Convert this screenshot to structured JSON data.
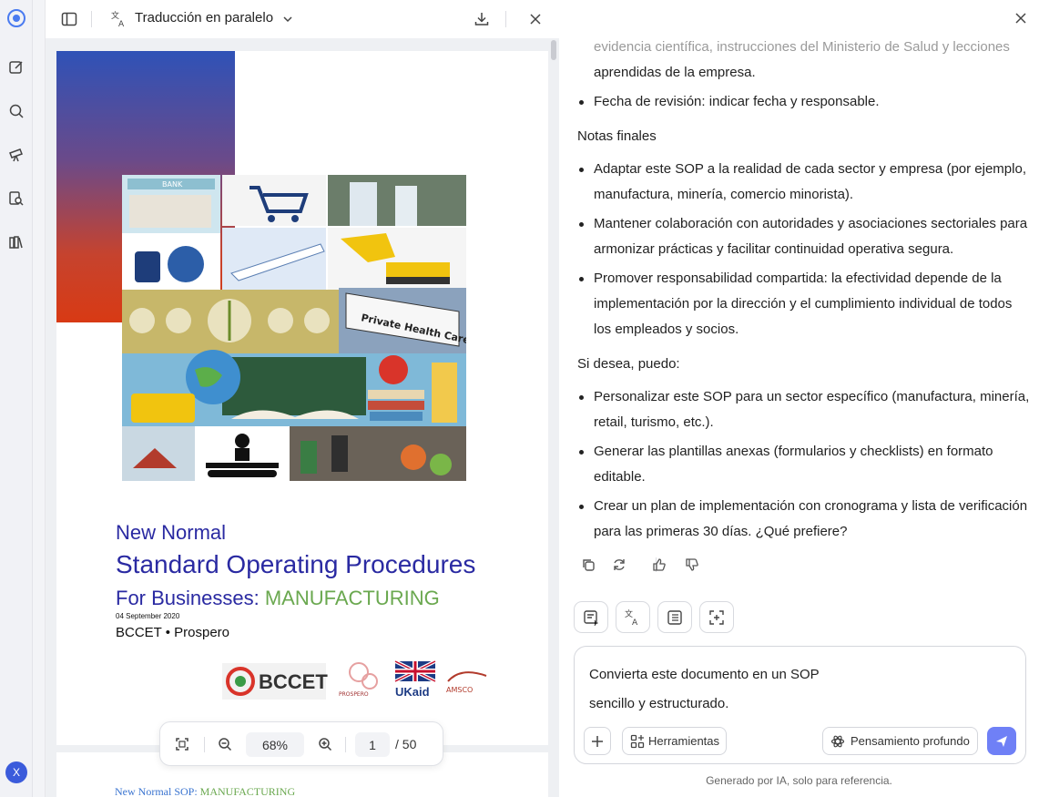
{
  "toolbar": {
    "title": "Traducción en paralelo"
  },
  "document": {
    "subtitle_top": "New Normal",
    "title": "Standard Operating Procedures",
    "for_businesses": "For Businesses: ",
    "sector": "MANUFACTURING",
    "date": "04 September 2020",
    "org": "BCCET • Prospero",
    "logo_text": "BCCET",
    "page2_prefix": "New Normal SOP: ",
    "page2_sector": "MANUFACTURING",
    "collage_labels": {
      "bank": "BANK",
      "health": "Private Health Care"
    },
    "logo_prospero": "PROSPERO",
    "logo_ukaid": "UKaid",
    "logo_amsco": "AMSCO"
  },
  "zoom": {
    "level": "68%",
    "page": "1",
    "total": "/ 50"
  },
  "chat": {
    "faded_line": "evidencia científica, instrucciones del Ministerio de Salud y lecciones",
    "cont_line": "aprendidas de la empresa.",
    "revision": "Fecha de revisión: indicar fecha y responsable.",
    "notes_heading": "Notas finales",
    "notes": [
      "Adaptar este SOP a la realidad de cada sector y empresa (por ejemplo, manufactura, minería, comercio minorista).",
      "Mantener colaboración con autoridades y asociaciones sectoriales para armonizar prácticas y facilitar continuidad operativa segura.",
      "Promover responsabilidad compartida: la efectividad depende de la implementación por la dirección y el cumplimiento individual de todos los empleados y socios."
    ],
    "offer_heading": "Si desea, puedo:",
    "offers": [
      "Personalizar este SOP para un sector específico (manufactura, minería, retail, turismo, etc.).",
      "Generar las plantillas anexas (formularios y checklists) en formato editable.",
      "Crear un plan de implementación con cronograma y lista de verificación para las primeras 30 días. ¿Qué prefiere?"
    ]
  },
  "composer": {
    "text": "Convierta este documento en un SOP sencillo y estructurado.",
    "tools_label": "Herramientas",
    "deep_label": "Pensamiento profundo"
  },
  "footer": "Generado por IA, solo para referencia.",
  "user": {
    "initial": "X"
  }
}
